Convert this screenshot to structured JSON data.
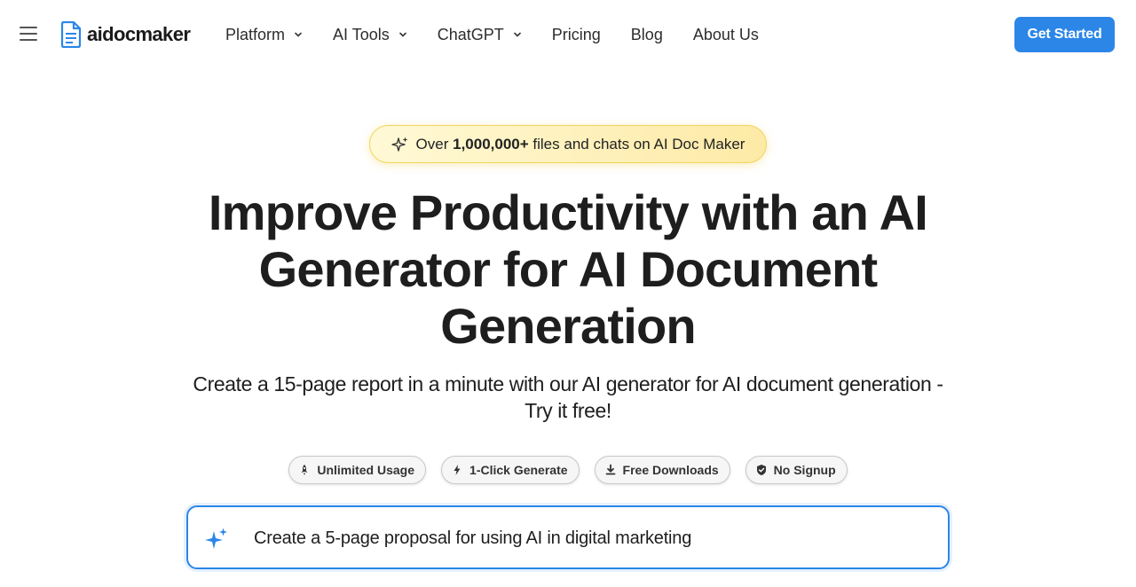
{
  "header": {
    "logo_text": "aidocmaker",
    "nav": [
      {
        "label": "Platform",
        "dropdown": true
      },
      {
        "label": "AI Tools",
        "dropdown": true
      },
      {
        "label": "ChatGPT",
        "dropdown": true
      },
      {
        "label": "Pricing",
        "dropdown": false
      },
      {
        "label": "Blog",
        "dropdown": false
      },
      {
        "label": "About Us",
        "dropdown": false
      }
    ],
    "cta_label": "Get Started"
  },
  "badge": {
    "prefix": "Over",
    "highlight": "1,000,000+",
    "suffix": "files and chats on AI Doc Maker"
  },
  "hero": {
    "title_line1": "Improve Productivity with an AI",
    "title_line2": "Generator for AI Document",
    "title_line3": "Generation",
    "subtitle_line1": "Create a 15-page report in a minute with our AI generator for AI document generation -",
    "subtitle_line2": "Try it free!"
  },
  "features": [
    {
      "label": "Unlimited Usage",
      "icon": "rocket-icon"
    },
    {
      "label": "1-Click Generate",
      "icon": "lightning-icon"
    },
    {
      "label": "Free Downloads",
      "icon": "download-icon"
    },
    {
      "label": "No Signup",
      "icon": "shield-check-icon"
    }
  ],
  "prompt": {
    "placeholder": "Create a 5-page proposal for using AI in digital marketing"
  },
  "colors": {
    "accent": "#2b86e8",
    "badge_bg": "#fdeaa6",
    "badge_border": "#f2d45c"
  }
}
